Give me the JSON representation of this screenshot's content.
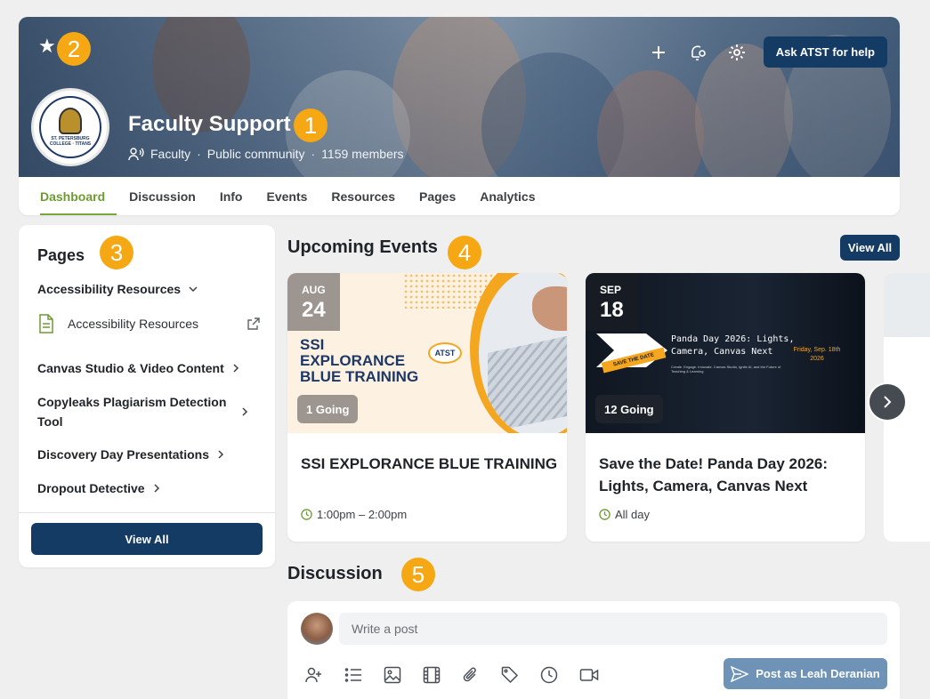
{
  "header": {
    "title": "Faculty Support",
    "audience": "Faculty",
    "visibility": "Public community",
    "members": "1159 members",
    "ask_button": "Ask ATST for help",
    "logo_text": "ST. PETERSBURG COLLEGE · TITANS",
    "icons": [
      "star-icon",
      "plus-icon",
      "bell-gear-icon",
      "settings-icon"
    ]
  },
  "markers": [
    "1",
    "2",
    "3",
    "4",
    "5"
  ],
  "tabs": [
    {
      "label": "Dashboard",
      "active": true
    },
    {
      "label": "Discussion"
    },
    {
      "label": "Info"
    },
    {
      "label": "Events"
    },
    {
      "label": "Resources"
    },
    {
      "label": "Pages"
    },
    {
      "label": "Analytics"
    }
  ],
  "pages": {
    "title": "Pages",
    "group_open": "Accessibility Resources",
    "sub_item": "Accessibility Resources",
    "items": [
      "Canvas Studio & Video Content",
      "Copyleaks Plagiarism Detection Tool",
      "Discovery Day Presentations",
      "Dropout Detective"
    ],
    "view_all": "View All"
  },
  "events": {
    "title": "Upcoming Events",
    "view_all": "View All",
    "cards": [
      {
        "month": "AUG",
        "day": "24",
        "image_text": "SSI EXPLORANCE BLUE TRAINING",
        "image_logo": "ATST",
        "going": "1 Going",
        "name": "SSI EXPLORANCE BLUE TRAINING",
        "time": "1:00pm – 2:00pm"
      },
      {
        "month": "SEP",
        "day": "18",
        "image_text": "Panda Day 2026: Lights, Camera, Canvas Next",
        "image_date": "Friday, Sep. 18th 2026",
        "image_sub": "Create. Engage. Innovate. Canvas Studio, Ignite AI, and the Future of Teaching & Learning",
        "image_tag": "SAVE THE DATE",
        "going": "12 Going",
        "name": "Save the Date! Panda Day 2026: Lights, Camera, Canvas Next",
        "time": "All day"
      }
    ]
  },
  "discussion": {
    "title": "Discussion",
    "placeholder": "Write a post",
    "post_button": "Post as Leah Deranian",
    "tools": [
      "add-people-icon",
      "list-icon",
      "image-icon",
      "video-film-icon",
      "attachment-icon",
      "tag-icon",
      "clock-icon",
      "video-camera-icon"
    ]
  },
  "colors": {
    "primary": "#143b64",
    "accent_green": "#6e9a33",
    "marker": "#f6a714"
  }
}
